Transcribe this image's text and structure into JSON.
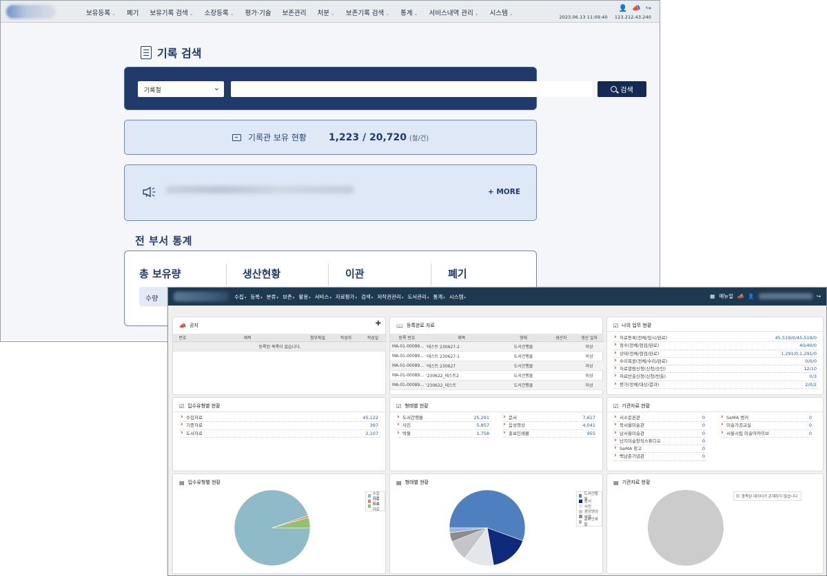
{
  "back": {
    "menu": [
      {
        "label": "보유등록",
        "caret": true
      },
      {
        "label": "폐기",
        "caret": false
      },
      {
        "label": "보유기록 검색",
        "caret": true
      },
      {
        "label": "소장등록",
        "caret": true
      },
      {
        "label": "평가·기술",
        "caret": false
      },
      {
        "label": "보존관리",
        "caret": false
      },
      {
        "label": "처분",
        "caret": true
      },
      {
        "label": "보존기록 검색",
        "caret": true
      },
      {
        "label": "통계",
        "caret": true
      },
      {
        "label": "서비스내역 관리",
        "caret": true
      },
      {
        "label": "시스템",
        "caret": true
      }
    ],
    "datetime": "2023.06.13 11:09:40",
    "ip": "123.212.43.240",
    "search_title": "기록 검색",
    "search_select": "기록철",
    "search_button": "검색",
    "holdings_label": "기록관 보유 현황",
    "holdings_value": "1,223 / 20,720",
    "holdings_unit": "(철/건)",
    "more": "+ MORE",
    "stats_title": "전 부서 통계",
    "stats_cols": [
      "총 보유량",
      "생산현황",
      "이관",
      "폐기"
    ],
    "qty_label": "수량"
  },
  "front": {
    "menu": [
      {
        "label": "수집"
      },
      {
        "label": "등록"
      },
      {
        "label": "분류"
      },
      {
        "label": "보존"
      },
      {
        "label": "활용"
      },
      {
        "label": "서비스"
      },
      {
        "label": "자료평가"
      },
      {
        "label": "검색"
      },
      {
        "label": "저작권관리"
      },
      {
        "label": "도서관리"
      },
      {
        "label": "통계"
      },
      {
        "label": "시스템"
      }
    ],
    "manual": "메뉴얼",
    "notice": {
      "title": "공지",
      "headers": [
        "번호",
        "제목",
        "첨부파일",
        "작성자",
        "작성일"
      ],
      "empty": "등록된 목록이 없습니다."
    },
    "registered": {
      "title": "등록완료 자료",
      "headers": [
        "등록 번호",
        "제목",
        "형태",
        "생산자",
        "생산 일자"
      ],
      "rows": [
        [
          "MA-01-00089...",
          "'테스트 230627-2",
          "도서간행물",
          "",
          "미상"
        ],
        [
          "MA-01-00089...",
          "'테스트 230627-1",
          "도서간행물",
          "",
          "미상"
        ],
        [
          "MA-01-00089...",
          "'테스트 230627",
          "도서간행물",
          "",
          "미상"
        ],
        [
          "MA-01-00089...",
          "'230622_테스트2",
          "도서간행물",
          "",
          "미상"
        ],
        [
          "MA-01-00089...",
          "'230622_테스트",
          "도서간행물",
          "",
          "미상"
        ]
      ]
    },
    "my_work": {
      "title": "나의 업무 현황",
      "rows": [
        [
          "자료등록(전체/임시/완료)",
          "45,519/0/45,519/0"
        ],
        [
          "정수(전체/점검/완료)",
          "40/40/0"
        ],
        [
          "상태(전체/점검/완료)",
          "1,291/0,1,291/0"
        ],
        [
          "수리복원(전체/수리/완료)",
          "0/0/0"
        ],
        [
          "자료열람신청(신청/승인)",
          "12/10"
        ],
        [
          "자료반출신청(신청/반출)",
          "0/3"
        ],
        [
          "평가(전체/대상/결과)",
          "2/0/2"
        ]
      ]
    },
    "intake": {
      "title": "입수유형별 현황",
      "rows": [
        [
          "수집자료",
          "45,122"
        ],
        [
          "기증자료",
          "397"
        ],
        [
          "도서자료",
          "2,107"
        ]
      ]
    },
    "form": {
      "title": "형태별 현황",
      "left": [
        [
          "도서간행물",
          "25,291"
        ],
        [
          "사진",
          "5,857"
        ],
        [
          "박물",
          "1,758"
        ]
      ],
      "right": [
        [
          "문서",
          "7,617"
        ],
        [
          "음성영상",
          "4,041"
        ],
        [
          "홍보인쇄물",
          "955"
        ]
      ]
    },
    "org": {
      "title": "기관자료 현황",
      "left": [
        [
          "서소문본관",
          "0"
        ],
        [
          "북서울미술관",
          "0"
        ],
        [
          "남서울미술관",
          "0"
        ],
        [
          "난지미술창작스튜디오",
          "0"
        ],
        [
          "SeMA 창고",
          "0"
        ],
        [
          "백남준기념관",
          "0"
        ]
      ],
      "right": [
        [
          "SeMA 벙커",
          "0"
        ],
        [
          "미술가공교실",
          "0"
        ],
        [
          "서울시립 미술아카이브",
          "0"
        ]
      ]
    },
    "chart_intake_title": "입수유형별 현황",
    "chart_form_title": "형태별 현황",
    "chart_org_title": "기관자료 현황",
    "chart_org_empty": "충족된 데이터가 존재하지 않습니다."
  },
  "chart_data": [
    {
      "type": "pie",
      "title": "입수유형별 현황",
      "categories": [
        "수집자료",
        "기증자료",
        "도서자료"
      ],
      "values": [
        45122,
        397,
        2107
      ],
      "colors": [
        "#8fbbc9",
        "#e0826a",
        "#93c06c"
      ]
    },
    {
      "type": "pie",
      "title": "형태별 현황",
      "categories": [
        "도서간행물",
        "문서",
        "사진",
        "음성영상",
        "박물",
        "홍보인쇄물"
      ],
      "values": [
        25291,
        7617,
        5857,
        4041,
        1758,
        955
      ],
      "colors": [
        "#4e7fbe",
        "#0f2a7a",
        "#e3e6ea",
        "#c3c5c8",
        "#8d8d8d",
        "#9eb5e3"
      ]
    },
    {
      "type": "pie",
      "title": "기관자료 현황",
      "categories": [],
      "values": [],
      "colors": [
        "#cccccc"
      ]
    }
  ]
}
